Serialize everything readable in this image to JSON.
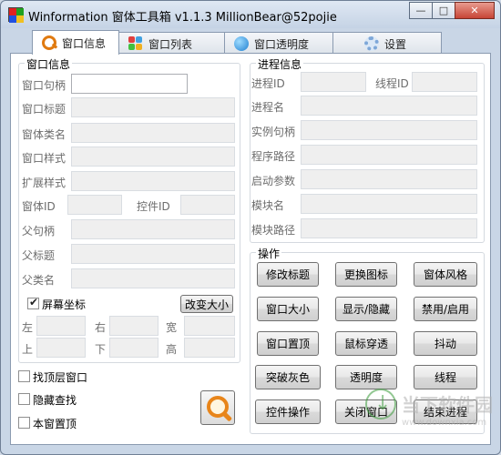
{
  "window": {
    "title": "Winformation 窗体工具箱 v1.1.3  MillionBear@52pojie",
    "minimize": "—",
    "maximize": "□",
    "close": "✕"
  },
  "tabs": [
    {
      "label": "窗口信息",
      "icon": "search-icon",
      "active": true
    },
    {
      "label": "窗口列表",
      "icon": "grid-icon",
      "active": false
    },
    {
      "label": "窗口透明度",
      "icon": "globe-icon",
      "active": false
    },
    {
      "label": "设置",
      "icon": "gear-icon",
      "active": false
    }
  ],
  "window_info": {
    "title": "窗口信息",
    "fields": {
      "handle": {
        "label": "窗口句柄",
        "value": ""
      },
      "caption": {
        "label": "窗口标题",
        "value": ""
      },
      "class_name": {
        "label": "窗体类名",
        "value": ""
      },
      "style": {
        "label": "窗口样式",
        "value": ""
      },
      "ex_style": {
        "label": "扩展样式",
        "value": ""
      },
      "window_id": {
        "label": "窗体ID",
        "value": ""
      },
      "control_id": {
        "label": "控件ID",
        "value": ""
      },
      "parent_handle": {
        "label": "父句柄",
        "value": ""
      },
      "parent_title": {
        "label": "父标题",
        "value": ""
      },
      "parent_class": {
        "label": "父类名",
        "value": ""
      }
    },
    "screen_coords": {
      "label": "屏幕坐标",
      "checked": true
    },
    "resize_button": "改变大小",
    "coords": {
      "left": "左",
      "right": "右",
      "width": "宽",
      "top": "上",
      "bottom": "下",
      "height": "高"
    }
  },
  "options": {
    "find_top_window": {
      "label": "找顶层窗口",
      "checked": false
    },
    "hide_on_find": {
      "label": "隐藏查找",
      "checked": false
    },
    "topmost": {
      "label": "本窗置顶",
      "checked": false
    }
  },
  "process_info": {
    "title": "进程信息",
    "process_id": {
      "label": "进程ID",
      "value": ""
    },
    "thread_id": {
      "label": "线程ID",
      "value": ""
    },
    "process_name": {
      "label": "进程名",
      "value": ""
    },
    "instance_handle": {
      "label": "实例句柄",
      "value": ""
    },
    "program_path": {
      "label": "程序路径",
      "value": ""
    },
    "startup_args": {
      "label": "启动参数",
      "value": ""
    },
    "module_name": {
      "label": "模块名",
      "value": ""
    },
    "module_path": {
      "label": "模块路径",
      "value": ""
    }
  },
  "actions": {
    "title": "操作",
    "buttons": [
      "修改标题",
      "更换图标",
      "窗体风格",
      "窗口大小",
      "显示/隐藏",
      "禁用/启用",
      "窗口置顶",
      "鼠标穿透",
      "抖动",
      "突破灰色",
      "透明度",
      "线程",
      "控件操作",
      "关闭窗口",
      "结束进程"
    ]
  },
  "watermark": {
    "name": "当下软件园",
    "url": "www.downxia.com"
  }
}
